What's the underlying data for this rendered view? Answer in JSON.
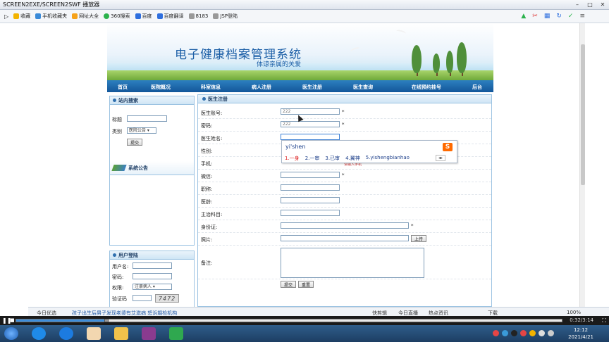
{
  "window": {
    "title": "SCREEN2EXE/SCREEN2SWF 播放器"
  },
  "favorites": [
    {
      "label": "收藏",
      "color": "#f2b300"
    },
    {
      "label": "手机收藏夹",
      "color": "#3a8ad8"
    },
    {
      "label": "网址大全",
      "color": "#f6a21a"
    },
    {
      "label": "360搜索",
      "color": "#2bb24c"
    },
    {
      "label": "百度",
      "color": "#2f6fde"
    },
    {
      "label": "百度翻译",
      "color": "#2f6fde"
    },
    {
      "label": "8183",
      "color": "#999999"
    },
    {
      "label": "JSP登陆",
      "color": "#999999"
    }
  ],
  "banner": {
    "title": "电子健康档案管理系统",
    "subtitle": "体谅亲属的关爱"
  },
  "nav": [
    "首页",
    "医院概况",
    "科室信息",
    "病人注册",
    "医生注册",
    "医生查询",
    "在线预约挂号",
    "后台"
  ],
  "sidebar": {
    "search": {
      "title": "站内搜索",
      "title_label": "标题",
      "category_label": "类别",
      "category_value": "医院公告",
      "submit": "提交"
    },
    "announce": {
      "title": "系统公告"
    },
    "login": {
      "title": "用户登陆",
      "user_label": "用户名:",
      "pwd_label": "密码:",
      "perm_label": "权限:",
      "perm_value": "注册病人",
      "code_label": "验证码",
      "code_value": "7472"
    }
  },
  "form": {
    "title": "医生注册",
    "fields": [
      {
        "label": "医生账号:",
        "value": "222",
        "star": "*"
      },
      {
        "label": "密码:",
        "value": "222",
        "star": "*"
      },
      {
        "label": "医生姓名:",
        "value": "",
        "star": ""
      },
      {
        "label": "性别:",
        "value": "",
        "star": ""
      },
      {
        "label": "手机:",
        "value": "",
        "star": ""
      },
      {
        "label": "微信:",
        "value": "",
        "star": "*"
      },
      {
        "label": "职称:",
        "value": "",
        "star": ""
      },
      {
        "label": "医龄:",
        "value": "",
        "star": ""
      },
      {
        "label": "主治科目:",
        "value": "",
        "star": ""
      },
      {
        "label": "身份证:",
        "value": "",
        "star": "*"
      },
      {
        "label": "照片:",
        "value": "",
        "star": ""
      },
      {
        "label": "备注:",
        "value": "",
        "star": ""
      }
    ],
    "upload": "上传",
    "submit": "提交",
    "reset": "重置",
    "phone_hint": "请输入手机"
  },
  "ime": {
    "pinyin": "yi'shen",
    "candidates": [
      "1.一身",
      "2.一审",
      "3.已审",
      "4.翼神",
      "5.yishengbianhao"
    ],
    "logo": "S"
  },
  "statusbar": {
    "left": "今日优选",
    "news": "孩子出生后男子发现老婆有艾滋病 怒诉婚检机构",
    "fast": "快剪辑",
    "live": "今日直播",
    "hot": "热点资讯",
    "download": "下载",
    "zoom": "100%"
  },
  "player": {
    "time": "0:32/3:14",
    "progress": 0.165
  },
  "taskbar": {
    "time": "12:12",
    "date": "2021/4/21"
  }
}
